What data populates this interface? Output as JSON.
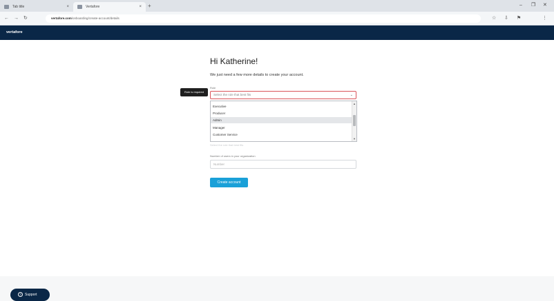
{
  "browser": {
    "tabs": [
      {
        "label": "Tab title",
        "close": "×"
      },
      {
        "label": "Vertafore",
        "close": "×"
      }
    ],
    "new_tab": "+",
    "window_controls": {
      "minimize": "–",
      "maximize": "❐",
      "close": "✕"
    },
    "nav": {
      "back": "←",
      "forward": "→",
      "reload": "↻"
    },
    "url": {
      "host": "vertafore.com",
      "path": "/onboarding/create-account/details"
    },
    "toolbar_icons": [
      "☆",
      "⇩",
      "⚑",
      "⋮"
    ]
  },
  "app": {
    "brand": "vertafore"
  },
  "main": {
    "greeting": "Hi Katherine!",
    "lead": "We just need a few more details to create your account.",
    "field1": {
      "label": "Role",
      "placeholder": "Select the role that best fits",
      "caret": "⌄",
      "tooltip": "Role is required"
    },
    "dropdown": {
      "options": [
        "Executive",
        "Producer",
        "Admin",
        "Manager",
        "Customer Service"
      ],
      "selected_index": 2,
      "scroll_up": "▲",
      "scroll_down": "▼"
    },
    "faded_field": "Select the role that best fits",
    "field2": {
      "label": "Number of users in your organization",
      "placeholder": "Number"
    },
    "submit_label": "Create account"
  },
  "support": {
    "label": "Support",
    "icon": "?"
  },
  "colors": {
    "navbar": "#0a2747",
    "accent": "#1aa0d8",
    "error_border": "#d9545a"
  }
}
